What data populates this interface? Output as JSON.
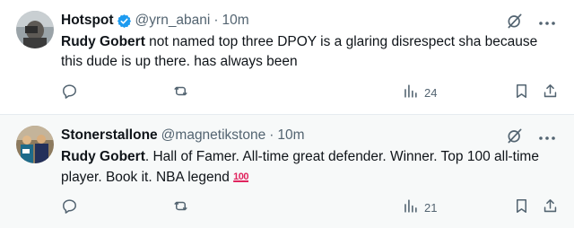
{
  "posts": [
    {
      "display_name": "Hotspot",
      "verified": true,
      "handle": "@yrn_abani",
      "separator": "·",
      "time": "10m",
      "text_bold": "Rudy Gobert",
      "text_rest": " not named top three DPOY is a glaring disrespect sha because this dude is up there. has always been",
      "views": "24"
    },
    {
      "display_name": "Stonerstallone",
      "verified": false,
      "handle": "@magnetikstone",
      "separator": "·",
      "time": "10m",
      "text_bold": "Rudy Gobert",
      "text_rest": ". Hall of Famer. All-time great defender. Winner. Top 100 all-time player. Book it. NBA legend ",
      "emoji": "100",
      "views": "21"
    }
  ],
  "icons": {
    "verified": "verified-badge-icon",
    "grok": "grok-icon",
    "more": "more-icon",
    "reply": "reply-icon",
    "repost": "repost-icon",
    "views": "views-icon",
    "bookmark": "bookmark-icon",
    "share": "share-icon"
  },
  "colors": {
    "verified": "#1d9bf0",
    "secondary_text": "#536471",
    "hover_background": "#f7f9f9",
    "emoji_red": "#e0245e"
  }
}
